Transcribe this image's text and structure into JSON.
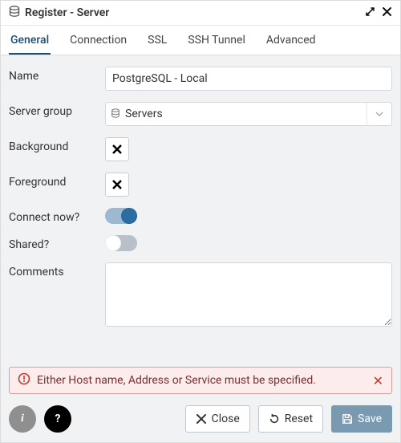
{
  "window": {
    "title": "Register - Server"
  },
  "tabs": [
    {
      "label": "General"
    },
    {
      "label": "Connection"
    },
    {
      "label": "SSL"
    },
    {
      "label": "SSH Tunnel"
    },
    {
      "label": "Advanced"
    }
  ],
  "form": {
    "name_label": "Name",
    "name_value": "PostgreSQL - Local",
    "server_group_label": "Server group",
    "server_group_value": "Servers",
    "background_label": "Background",
    "foreground_label": "Foreground",
    "connect_now_label": "Connect now?",
    "connect_now_value": true,
    "shared_label": "Shared?",
    "shared_value": false,
    "comments_label": "Comments",
    "comments_value": ""
  },
  "error": {
    "message": "Either Host name, Address or Service must be specified."
  },
  "buttons": {
    "close": "Close",
    "reset": "Reset",
    "save": "Save"
  }
}
